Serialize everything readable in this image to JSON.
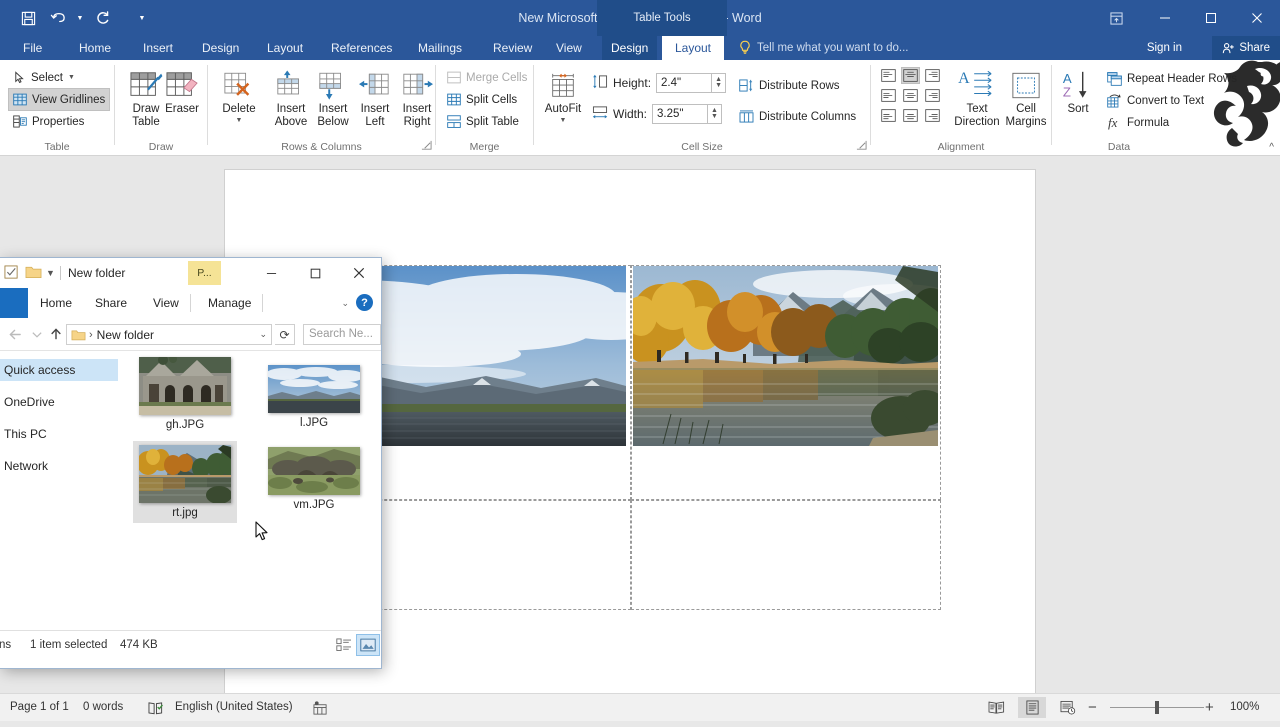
{
  "word": {
    "title": "New Microsoft Word Document.docx - Word",
    "contextual_tab_group": "Table Tools",
    "quick_access": [
      {
        "name": "save",
        "icon": "save-icon"
      },
      {
        "name": "undo",
        "icon": "undo-icon"
      },
      {
        "name": "redo",
        "icon": "redo-icon"
      },
      {
        "name": "customize",
        "icon": "customize-qat-icon"
      }
    ],
    "tabs": [
      {
        "label": "File"
      },
      {
        "label": "Home"
      },
      {
        "label": "Insert"
      },
      {
        "label": "Design"
      },
      {
        "label": "Layout"
      },
      {
        "label": "References"
      },
      {
        "label": "Mailings"
      },
      {
        "label": "Review"
      },
      {
        "label": "View"
      },
      {
        "label": "Design"
      },
      {
        "label": "Layout"
      }
    ],
    "tellme_placeholder": "Tell me what you want to do...",
    "sign_in": "Sign in",
    "share": "Share",
    "ribbon": {
      "groups": [
        {
          "label": "Table"
        },
        {
          "label": "Draw"
        },
        {
          "label": "Rows & Columns"
        },
        {
          "label": "Merge"
        },
        {
          "label": "Cell Size"
        },
        {
          "label": "Alignment"
        },
        {
          "label": "Data"
        }
      ],
      "table": {
        "select": "Select",
        "view_gridlines": "View Gridlines",
        "properties": "Properties"
      },
      "draw": {
        "draw_table_l1": "Draw",
        "draw_table_l2": "Table",
        "eraser": "Eraser"
      },
      "rows_columns": {
        "delete": "Delete",
        "insert_above_l1": "Insert",
        "insert_above_l2": "Above",
        "insert_below_l1": "Insert",
        "insert_below_l2": "Below",
        "insert_left_l1": "Insert",
        "insert_left_l2": "Left",
        "insert_right_l1": "Insert",
        "insert_right_l2": "Right"
      },
      "merge": {
        "merge_cells": "Merge Cells",
        "split_cells": "Split Cells",
        "split_table": "Split Table"
      },
      "cell_size": {
        "autofit": "AutoFit",
        "height_label": "Height:",
        "height_value": "2.4\"",
        "width_label": "Width:",
        "width_value": "3.25\"",
        "distribute_rows": "Distribute Rows",
        "distribute_columns": "Distribute Columns"
      },
      "alignment": {
        "text_direction_l1": "Text",
        "text_direction_l2": "Direction",
        "cell_margins_l1": "Cell",
        "cell_margins_l2": "Margins",
        "selected_cell": "top-center"
      },
      "data": {
        "sort": "Sort",
        "repeat_header_rows": "Repeat Header Rows",
        "convert_to_text": "Convert to Text",
        "formula": "Formula"
      }
    },
    "status": {
      "page": "Page 1 of 1",
      "words": "0 words",
      "language": "English (United States)",
      "zoom": "100%",
      "zoom_minus": "−",
      "zoom_plus": "+"
    }
  },
  "explorer": {
    "title": "New folder",
    "picture_tools_tab": "P...",
    "tabs": [
      {
        "label": "Home"
      },
      {
        "label": "Share"
      },
      {
        "label": "View"
      },
      {
        "label": "Manage"
      }
    ],
    "breadcrumb": "New folder",
    "search_placeholder": "Search Ne...",
    "nav": [
      {
        "label": "Quick access",
        "selected": true
      },
      {
        "label": "OneDrive",
        "selected": false
      },
      {
        "label": "This PC",
        "selected": false
      },
      {
        "label": "Network",
        "selected": false
      }
    ],
    "files": [
      {
        "name": "gh.JPG",
        "selected": false,
        "thumb": "stone-church"
      },
      {
        "name": "l.JPG",
        "selected": false,
        "thumb": "lake-clouds"
      },
      {
        "name": "rt.jpg",
        "selected": true,
        "thumb": "autumn-river"
      },
      {
        "name": "vm.JPG",
        "selected": false,
        "thumb": "rocky-hills"
      }
    ],
    "status": {
      "items_partial": "ns",
      "selection": "1 item selected",
      "size": "474 KB"
    }
  },
  "document": {
    "table": {
      "rows": 2,
      "cols": 2,
      "cells": [
        {
          "row": 0,
          "col": 0,
          "image": "lake-clouds"
        },
        {
          "row": 0,
          "col": 1,
          "image": "autumn-river"
        },
        {
          "row": 1,
          "col": 0,
          "image": null
        },
        {
          "row": 1,
          "col": 1,
          "image": null
        }
      ]
    }
  },
  "colors": {
    "word_chrome": "#2b579a",
    "word_chrome_dark": "#204d89",
    "explorer_accent": "#1a6dbf",
    "selection_blue": "#cce4f7",
    "contextual_yellow": "#f5e396",
    "workspace_gray": "#e7e7e7"
  }
}
